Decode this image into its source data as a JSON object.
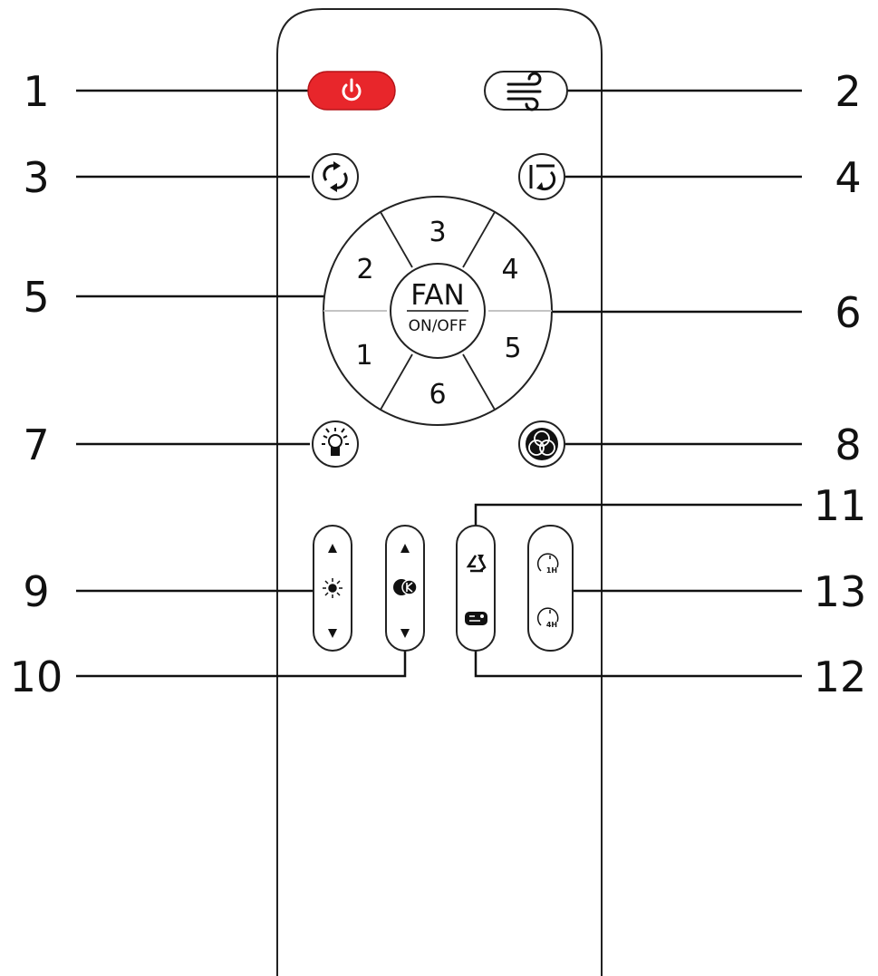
{
  "callouts": [
    "1",
    "2",
    "3",
    "4",
    "5",
    "6",
    "7",
    "8",
    "9",
    "10",
    "11",
    "12",
    "13"
  ],
  "fan_button": {
    "label": "FAN",
    "sublabel": "ON/OFF"
  },
  "speed_ring": [
    "1",
    "2",
    "3",
    "4",
    "5",
    "6"
  ],
  "timer_labels": {
    "one_hour": "1H",
    "four_hour": "4H"
  },
  "colors": {
    "power_button": "#e8262b",
    "outline": "#222222",
    "body": "#ffffff"
  },
  "icons": {
    "power": "power-icon",
    "wind": "wind-icon",
    "reverse": "reverse-direction-icon",
    "oscillate": "swing-icon",
    "light": "light-bulb-icon",
    "color": "rgb-color-icon",
    "brightness": "brightness-icon",
    "color_temperature": "color-temperature-icon",
    "natural_wind": "natural-wind-icon",
    "sleep": "sleep-mode-icon",
    "timer": "timer-icon"
  }
}
